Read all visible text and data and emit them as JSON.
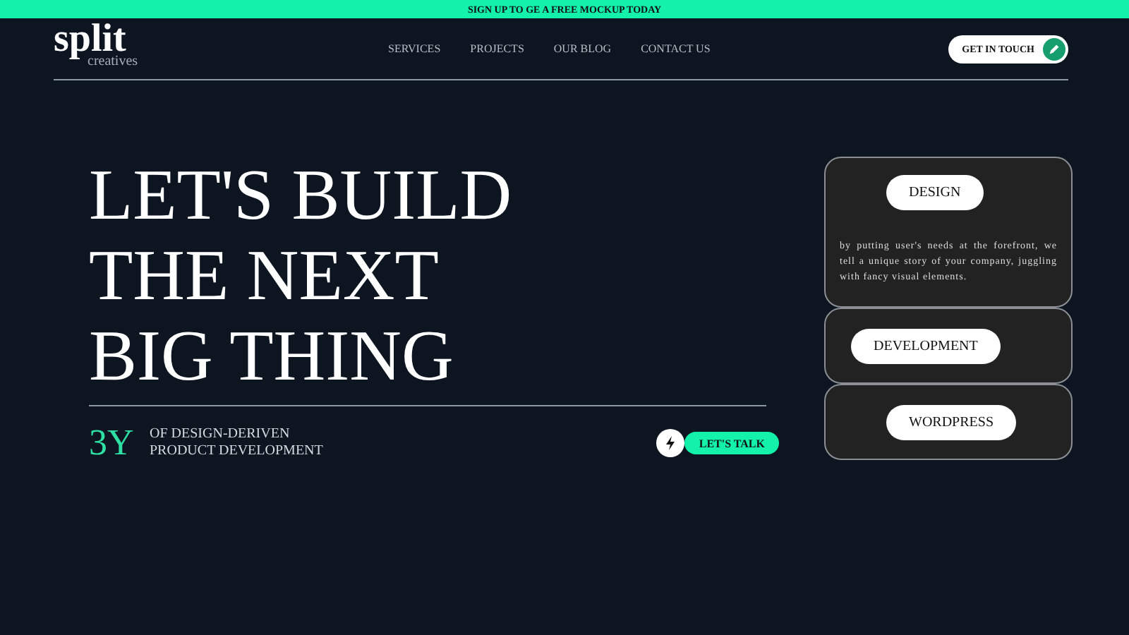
{
  "banner": "SIGN UP TO GE A FREE MOCKUP TODAY",
  "logo": {
    "name": "split",
    "tagline": "creatives"
  },
  "nav": [
    "SERVICES",
    "PROJECTS",
    "OUR BLOG",
    "CONTACT US"
  ],
  "cta": "GET IN TOUCH",
  "headline": [
    "LET'S BUILD",
    "THE NEXT",
    "BIG THING"
  ],
  "stat": {
    "value": "3Y",
    "lines": [
      "OF DESIGN-DERIVEN",
      "PRODUCT DEVELOPMENT"
    ]
  },
  "talk_button": "LET'S TALK",
  "services": [
    {
      "title": "DESIGN",
      "expanded": true,
      "description": "by putting user's needs at the forefront, we tell a unique story of your company, juggling with fancy visual elements."
    },
    {
      "title": "DEVELOPMENT",
      "expanded": false
    },
    {
      "title": "WORDPRESS",
      "expanded": false
    }
  ]
}
